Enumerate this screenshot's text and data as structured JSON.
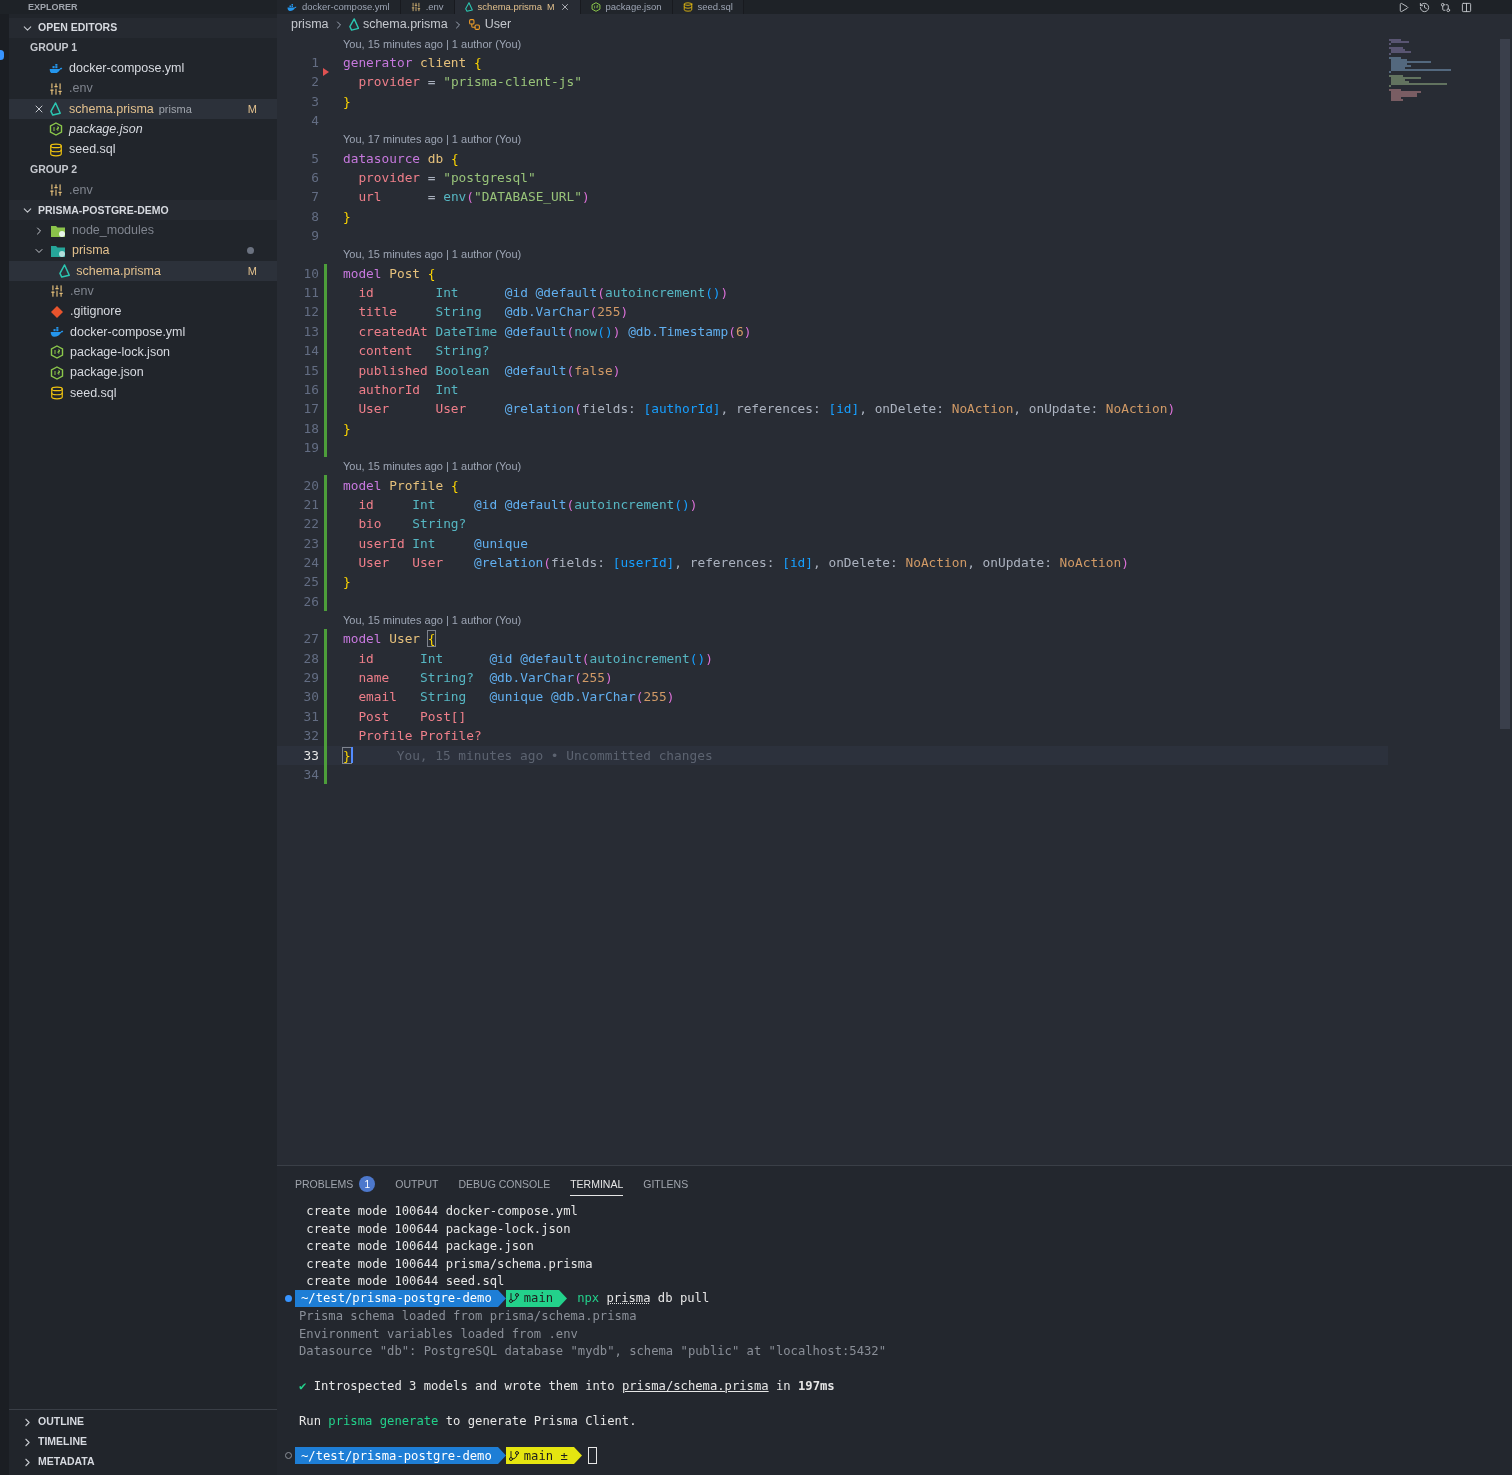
{
  "explorer_title": "EXPLORER",
  "tabs": [
    {
      "label": "docker-compose.yml",
      "kind": "docker",
      "selected": false
    },
    {
      "label": ".env",
      "kind": "env",
      "selected": false
    },
    {
      "label": "schema.prisma",
      "kind": "prisma",
      "selected": true,
      "badge": "M"
    },
    {
      "label": "package.json",
      "kind": "node",
      "selected": false
    },
    {
      "label": "seed.sql",
      "kind": "database",
      "selected": false
    }
  ],
  "open_editors": {
    "title": "OPEN EDITORS",
    "expanded": true,
    "groups": [
      {
        "title": "GROUP 1",
        "items": [
          {
            "name": "docker-compose.yml",
            "kind": "docker",
            "modified": false,
            "ignored": false,
            "selected": false,
            "preview": false
          },
          {
            "name": ".env",
            "kind": "env",
            "modified": false,
            "ignored": true,
            "selected": false,
            "preview": false
          },
          {
            "name": "schema.prisma",
            "kind": "prisma",
            "modified": true,
            "selected": true,
            "preview": false,
            "description": "prisma",
            "badge": "M"
          },
          {
            "name": "package.json",
            "kind": "node",
            "modified": false,
            "ignored": false,
            "selected": false,
            "preview": true
          },
          {
            "name": "seed.sql",
            "kind": "database",
            "modified": false,
            "ignored": false,
            "selected": false,
            "preview": false
          }
        ]
      },
      {
        "title": "GROUP 2",
        "items": [
          {
            "name": ".env",
            "kind": "env",
            "modified": false,
            "ignored": true,
            "selected": false,
            "preview": false
          }
        ]
      }
    ]
  },
  "project": {
    "title": "PRISMA-POSTGRE-DEMO",
    "expanded": true,
    "items": [
      {
        "name": "node_modules",
        "kind": "folder_node",
        "expanded": false,
        "modified": false,
        "ignored": true,
        "selected": false,
        "dot": false
      },
      {
        "name": "prisma",
        "kind": "folder_prisma",
        "expanded": true,
        "modified": true,
        "selected": false,
        "dot": true,
        "children": [
          {
            "name": "schema.prisma",
            "kind": "prisma",
            "modified": true,
            "selected": true,
            "dot": false,
            "badge": "M"
          }
        ]
      },
      {
        "name": ".env",
        "kind": "env",
        "modified": false,
        "ignored": true,
        "selected": false,
        "dot": false
      },
      {
        "name": ".gitignore",
        "kind": "git",
        "modified": false,
        "ignored": false,
        "selected": false,
        "dot": false
      },
      {
        "name": "docker-compose.yml",
        "kind": "docker",
        "modified": false,
        "ignored": false,
        "selected": false,
        "dot": false
      },
      {
        "name": "package-lock.json",
        "kind": "node",
        "modified": false,
        "ignored": false,
        "selected": false,
        "dot": false
      },
      {
        "name": "package.json",
        "kind": "node",
        "modified": false,
        "ignored": false,
        "selected": false,
        "dot": false
      },
      {
        "name": "seed.sql",
        "kind": "database",
        "modified": false,
        "ignored": false,
        "selected": false,
        "dot": false
      }
    ]
  },
  "bottom_sections": [
    {
      "title": "OUTLINE",
      "expanded": false
    },
    {
      "title": "TIMELINE",
      "expanded": false
    },
    {
      "title": "METADATA",
      "expanded": false
    }
  ],
  "breadcrumbs": [
    {
      "label": "prisma",
      "kind": "folder"
    },
    {
      "label": "schema.prisma",
      "kind": "prisma"
    },
    {
      "label": "User",
      "kind": "symbol"
    }
  ],
  "code": [
    {
      "kind": "blame",
      "text": "You, 15 minutes ago | 1 author (You)"
    },
    {
      "kind": "line",
      "num": "1",
      "added": false,
      "deleted": true,
      "current": false,
      "tokens": [
        {
          "kind": "kw",
          "text": "generator "
        },
        {
          "kind": "nm",
          "text": "client "
        },
        {
          "kind": "br",
          "text": "{"
        }
      ]
    },
    {
      "kind": "line",
      "num": "2",
      "added": false,
      "deleted": false,
      "current": false,
      "tokens": [
        {
          "kind": "fd",
          "text": "  provider"
        },
        {
          "kind": "pl",
          "text": " = "
        },
        {
          "kind": "st",
          "text": "\"prisma-client-js\""
        }
      ]
    },
    {
      "kind": "line",
      "num": "3",
      "added": false,
      "deleted": false,
      "current": false,
      "tokens": [
        {
          "kind": "br",
          "text": "}"
        }
      ]
    },
    {
      "kind": "line",
      "num": "4",
      "added": false,
      "deleted": false,
      "current": false
    },
    {
      "kind": "blame",
      "text": "You, 17 minutes ago | 1 author (You)"
    },
    {
      "kind": "line",
      "num": "5",
      "added": false,
      "deleted": false,
      "current": false,
      "tokens": [
        {
          "kind": "kw",
          "text": "datasource "
        },
        {
          "kind": "nm",
          "text": "db "
        },
        {
          "kind": "br",
          "text": "{"
        }
      ]
    },
    {
      "kind": "line",
      "num": "6",
      "added": false,
      "deleted": false,
      "current": false,
      "tokens": [
        {
          "kind": "fd",
          "text": "  provider"
        },
        {
          "kind": "pl",
          "text": " = "
        },
        {
          "kind": "st",
          "text": "\"postgresql\""
        }
      ]
    },
    {
      "kind": "line",
      "num": "7",
      "added": false,
      "deleted": false,
      "current": false,
      "tokens": [
        {
          "kind": "fd",
          "text": "  url"
        },
        {
          "kind": "pl",
          "text": "      = "
        },
        {
          "kind": "fn",
          "text": "env"
        },
        {
          "kind": "pk",
          "text": "("
        },
        {
          "kind": "st",
          "text": "\"DATABASE_URL\""
        },
        {
          "kind": "pk",
          "text": ")"
        }
      ]
    },
    {
      "kind": "line",
      "num": "8",
      "added": false,
      "deleted": false,
      "current": false,
      "tokens": [
        {
          "kind": "br",
          "text": "}"
        }
      ]
    },
    {
      "kind": "line",
      "num": "9",
      "added": false,
      "deleted": false,
      "current": false
    },
    {
      "kind": "blame",
      "text": "You, 15 minutes ago | 1 author (You)"
    },
    {
      "kind": "line",
      "num": "10",
      "added": true,
      "deleted": false,
      "current": false,
      "tokens": [
        {
          "kind": "kw",
          "text": "model "
        },
        {
          "kind": "nm",
          "text": "Post "
        },
        {
          "kind": "br",
          "text": "{"
        }
      ]
    },
    {
      "kind": "line",
      "num": "11",
      "added": true,
      "deleted": false,
      "current": false,
      "tokens": [
        {
          "kind": "fd",
          "text": "  id        "
        },
        {
          "kind": "ty",
          "text": "Int      "
        },
        {
          "kind": "at",
          "text": "@id @default"
        },
        {
          "kind": "pk",
          "text": "("
        },
        {
          "kind": "fn",
          "text": "autoincrement"
        },
        {
          "kind": "bl",
          "text": "()"
        },
        {
          "kind": "pk",
          "text": ")"
        }
      ]
    },
    {
      "kind": "line",
      "num": "12",
      "added": true,
      "deleted": false,
      "current": false,
      "tokens": [
        {
          "kind": "fd",
          "text": "  title     "
        },
        {
          "kind": "ty",
          "text": "String   "
        },
        {
          "kind": "at",
          "text": "@db.VarChar"
        },
        {
          "kind": "pk",
          "text": "("
        },
        {
          "kind": "nu",
          "text": "255"
        },
        {
          "kind": "pk",
          "text": ")"
        }
      ]
    },
    {
      "kind": "line",
      "num": "13",
      "added": true,
      "deleted": false,
      "current": false,
      "tokens": [
        {
          "kind": "fd",
          "text": "  createdAt "
        },
        {
          "kind": "ty",
          "text": "DateTime "
        },
        {
          "kind": "at",
          "text": "@default"
        },
        {
          "kind": "pk",
          "text": "("
        },
        {
          "kind": "fn",
          "text": "now"
        },
        {
          "kind": "bl",
          "text": "()"
        },
        {
          "kind": "pk",
          "text": ") "
        },
        {
          "kind": "at",
          "text": "@db.Timestamp"
        },
        {
          "kind": "pk",
          "text": "("
        },
        {
          "kind": "nu",
          "text": "6"
        },
        {
          "kind": "pk",
          "text": ")"
        }
      ]
    },
    {
      "kind": "line",
      "num": "14",
      "added": true,
      "deleted": false,
      "current": false,
      "tokens": [
        {
          "kind": "fd",
          "text": "  content   "
        },
        {
          "kind": "ty",
          "text": "String?"
        }
      ]
    },
    {
      "kind": "line",
      "num": "15",
      "added": true,
      "deleted": false,
      "current": false,
      "tokens": [
        {
          "kind": "fd",
          "text": "  published "
        },
        {
          "kind": "ty",
          "text": "Boolean  "
        },
        {
          "kind": "at",
          "text": "@default"
        },
        {
          "kind": "pk",
          "text": "("
        },
        {
          "kind": "cn",
          "text": "false"
        },
        {
          "kind": "pk",
          "text": ")"
        }
      ]
    },
    {
      "kind": "line",
      "num": "16",
      "added": true,
      "deleted": false,
      "current": false,
      "tokens": [
        {
          "kind": "fd",
          "text": "  authorId  "
        },
        {
          "kind": "ty",
          "text": "Int"
        }
      ]
    },
    {
      "kind": "line",
      "num": "17",
      "added": true,
      "deleted": false,
      "current": false,
      "tokens": [
        {
          "kind": "fd",
          "text": "  User      User     "
        },
        {
          "kind": "at",
          "text": "@relation"
        },
        {
          "kind": "pk",
          "text": "("
        },
        {
          "kind": "pl",
          "text": "fields: "
        },
        {
          "kind": "bl",
          "text": "[authorId]"
        },
        {
          "kind": "pl",
          "text": ", references: "
        },
        {
          "kind": "bl",
          "text": "[id]"
        },
        {
          "kind": "pl",
          "text": ", onDelete: "
        },
        {
          "kind": "cn",
          "text": "NoAction"
        },
        {
          "kind": "pl",
          "text": ", onUpdate: "
        },
        {
          "kind": "cn",
          "text": "NoAction"
        },
        {
          "kind": "pk",
          "text": ")"
        }
      ]
    },
    {
      "kind": "line",
      "num": "18",
      "added": true,
      "deleted": false,
      "current": false,
      "tokens": [
        {
          "kind": "br",
          "text": "}"
        }
      ]
    },
    {
      "kind": "line",
      "num": "19",
      "added": true,
      "deleted": false,
      "current": false
    },
    {
      "kind": "blame",
      "text": "You, 15 minutes ago | 1 author (You)"
    },
    {
      "kind": "line",
      "num": "20",
      "added": true,
      "deleted": false,
      "current": false,
      "tokens": [
        {
          "kind": "kw",
          "text": "model "
        },
        {
          "kind": "nm",
          "text": "Profile "
        },
        {
          "kind": "br",
          "text": "{"
        }
      ]
    },
    {
      "kind": "line",
      "num": "21",
      "added": true,
      "deleted": false,
      "current": false,
      "tokens": [
        {
          "kind": "fd",
          "text": "  id     "
        },
        {
          "kind": "ty",
          "text": "Int     "
        },
        {
          "kind": "at",
          "text": "@id @default"
        },
        {
          "kind": "pk",
          "text": "("
        },
        {
          "kind": "fn",
          "text": "autoincrement"
        },
        {
          "kind": "bl",
          "text": "()"
        },
        {
          "kind": "pk",
          "text": ")"
        }
      ]
    },
    {
      "kind": "line",
      "num": "22",
      "added": true,
      "deleted": false,
      "current": false,
      "tokens": [
        {
          "kind": "fd",
          "text": "  bio    "
        },
        {
          "kind": "ty",
          "text": "String?"
        }
      ]
    },
    {
      "kind": "line",
      "num": "23",
      "added": true,
      "deleted": false,
      "current": false,
      "tokens": [
        {
          "kind": "fd",
          "text": "  userId "
        },
        {
          "kind": "ty",
          "text": "Int     "
        },
        {
          "kind": "at",
          "text": "@unique"
        }
      ]
    },
    {
      "kind": "line",
      "num": "24",
      "added": true,
      "deleted": false,
      "current": false,
      "tokens": [
        {
          "kind": "fd",
          "text": "  User   User    "
        },
        {
          "kind": "at",
          "text": "@relation"
        },
        {
          "kind": "pk",
          "text": "("
        },
        {
          "kind": "pl",
          "text": "fields: "
        },
        {
          "kind": "bl",
          "text": "[userId]"
        },
        {
          "kind": "pl",
          "text": ", references: "
        },
        {
          "kind": "bl",
          "text": "[id]"
        },
        {
          "kind": "pl",
          "text": ", onDelete: "
        },
        {
          "kind": "cn",
          "text": "NoAction"
        },
        {
          "kind": "pl",
          "text": ", onUpdate: "
        },
        {
          "kind": "cn",
          "text": "NoAction"
        },
        {
          "kind": "pk",
          "text": ")"
        }
      ]
    },
    {
      "kind": "line",
      "num": "25",
      "added": true,
      "deleted": false,
      "current": false,
      "tokens": [
        {
          "kind": "br",
          "text": "}"
        }
      ]
    },
    {
      "kind": "line",
      "num": "26",
      "added": true,
      "deleted": false,
      "current": false
    },
    {
      "kind": "blame",
      "text": "You, 15 minutes ago | 1 author (You)"
    },
    {
      "kind": "line",
      "num": "27",
      "added": true,
      "deleted": false,
      "current": false,
      "tokens": [
        {
          "kind": "kw",
          "text": "model "
        },
        {
          "kind": "nm",
          "text": "User "
        },
        {
          "kind": "bm",
          "text": "{"
        }
      ]
    },
    {
      "kind": "line",
      "num": "28",
      "added": true,
      "deleted": false,
      "current": false,
      "tokens": [
        {
          "kind": "fd",
          "text": "  id      "
        },
        {
          "kind": "ty",
          "text": "Int      "
        },
        {
          "kind": "at",
          "text": "@id @default"
        },
        {
          "kind": "pk",
          "text": "("
        },
        {
          "kind": "fn",
          "text": "autoincrement"
        },
        {
          "kind": "bl",
          "text": "()"
        },
        {
          "kind": "pk",
          "text": ")"
        }
      ]
    },
    {
      "kind": "line",
      "num": "29",
      "added": true,
      "deleted": false,
      "current": false,
      "tokens": [
        {
          "kind": "fd",
          "text": "  name    "
        },
        {
          "kind": "ty",
          "text": "String?  "
        },
        {
          "kind": "at",
          "text": "@db.VarChar"
        },
        {
          "kind": "pk",
          "text": "("
        },
        {
          "kind": "nu",
          "text": "255"
        },
        {
          "kind": "pk",
          "text": ")"
        }
      ]
    },
    {
      "kind": "line",
      "num": "30",
      "added": true,
      "deleted": false,
      "current": false,
      "tokens": [
        {
          "kind": "fd",
          "text": "  email   "
        },
        {
          "kind": "ty",
          "text": "String   "
        },
        {
          "kind": "at",
          "text": "@unique @db.VarChar"
        },
        {
          "kind": "pk",
          "text": "("
        },
        {
          "kind": "nu",
          "text": "255"
        },
        {
          "kind": "pk",
          "text": ")"
        }
      ]
    },
    {
      "kind": "line",
      "num": "31",
      "added": true,
      "deleted": false,
      "current": false,
      "tokens": [
        {
          "kind": "fd",
          "text": "  Post    Post[]"
        }
      ]
    },
    {
      "kind": "line",
      "num": "32",
      "added": true,
      "deleted": false,
      "current": false,
      "tokens": [
        {
          "kind": "fd",
          "text": "  Profile Profile?"
        }
      ]
    },
    {
      "kind": "line",
      "num": "33",
      "added": true,
      "deleted": false,
      "current": true,
      "tokens": [
        {
          "kind": "bm",
          "text": "}"
        }
      ],
      "inline_blame": "You, 15 minutes ago • Uncommitted changes"
    },
    {
      "kind": "line",
      "num": "34",
      "added": true,
      "deleted": false,
      "current": false
    }
  ],
  "panel_tabs": [
    {
      "label": "PROBLEMS",
      "selected": false,
      "count": "1"
    },
    {
      "label": "OUTPUT",
      "selected": false
    },
    {
      "label": "DEBUG CONSOLE",
      "selected": false
    },
    {
      "label": "TERMINAL",
      "selected": true
    },
    {
      "label": "GITLENS",
      "selected": false
    }
  ],
  "terminal": [
    {
      "kind": "output",
      "text": " create mode 100644 docker-compose.yml"
    },
    {
      "kind": "output",
      "text": " create mode 100644 package-lock.json"
    },
    {
      "kind": "output",
      "text": " create mode 100644 package.json"
    },
    {
      "kind": "output",
      "text": " create mode 100644 prisma/schema.prisma"
    },
    {
      "kind": "output",
      "text": " create mode 100644 seed.sql"
    },
    {
      "kind": "prompt",
      "finished": true,
      "path": "~/test/prisma-postgre-demo",
      "branch": "main",
      "dirty": false,
      "cursor": false,
      "command": [
        {
          "kind": "cmd",
          "text": "npx "
        },
        {
          "kind": "ul",
          "text": "prisma"
        },
        {
          "kind": "pl",
          "text": " db pull"
        }
      ]
    },
    {
      "kind": "dim",
      "text": "Prisma schema loaded from prisma/schema.prisma"
    },
    {
      "kind": "dim",
      "text": "Environment variables loaded from .env"
    },
    {
      "kind": "dim",
      "text": "Datasource \"db\": PostgreSQL database \"mydb\", schema \"public\" at \"localhost:5432\""
    },
    {
      "kind": "blank"
    },
    {
      "kind": "success",
      "check": "✔",
      "before": "Introspected 3 models and wrote them into",
      "link": "prisma/schema.prisma",
      "after": "in **197ms**"
    },
    {
      "kind": "blank"
    },
    {
      "kind": "run",
      "parts": [
        {
          "kind": "pl",
          "text": "Run "
        },
        {
          "kind": "cmd",
          "text": "prisma generate"
        },
        {
          "kind": "pl",
          "text": " to generate Prisma Client."
        }
      ]
    },
    {
      "kind": "blank"
    },
    {
      "kind": "prompt",
      "finished": false,
      "path": "~/test/prisma-postgre-demo",
      "branch": "main ±",
      "dirty": true,
      "cursor": true
    }
  ]
}
